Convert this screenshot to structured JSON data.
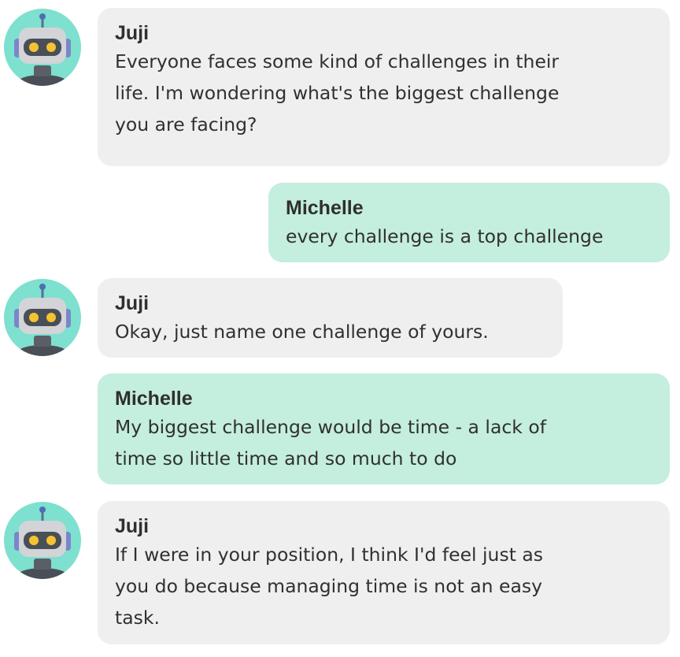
{
  "colors": {
    "bot_bubble": "#efefef",
    "user_bubble": "#c4eedd",
    "avatar_background": "#7ee0cf"
  },
  "messages": [
    {
      "role": "bot",
      "sender": "Juji",
      "avatar_icon": "robot-avatar-icon",
      "lines": [
        "Everyone faces some kind of challenges in their",
        "life. I'm wondering what's the biggest challenge",
        "you are facing?"
      ]
    },
    {
      "role": "user",
      "sender": "Michelle",
      "lines": [
        "every challenge is a top challenge"
      ]
    },
    {
      "role": "bot",
      "sender": "Juji",
      "avatar_icon": "robot-avatar-icon",
      "lines": [
        "Okay, just name one challenge of yours."
      ]
    },
    {
      "role": "user",
      "sender": "Michelle",
      "lines": [
        "My biggest challenge would be time - a lack of",
        "time so little time and so much to do"
      ]
    },
    {
      "role": "bot",
      "sender": "Juji",
      "avatar_icon": "robot-avatar-icon",
      "lines": [
        "If I were in your position, I think I'd feel just as",
        "you do because managing time is not an easy",
        "task."
      ]
    }
  ]
}
